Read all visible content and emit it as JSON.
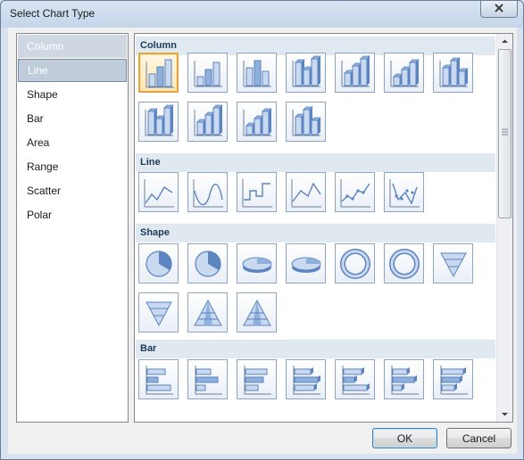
{
  "window": {
    "title": "Select Chart Type"
  },
  "categories": [
    {
      "label": "Column"
    },
    {
      "label": "Line"
    },
    {
      "label": "Shape"
    },
    {
      "label": "Bar"
    },
    {
      "label": "Area"
    },
    {
      "label": "Range"
    },
    {
      "label": "Scatter"
    },
    {
      "label": "Polar"
    }
  ],
  "sections": [
    {
      "label": "Column",
      "kind": "column",
      "count": 11
    },
    {
      "label": "Line",
      "kind": "line",
      "count": 6
    },
    {
      "label": "Shape",
      "kind": "shape",
      "count": 10
    },
    {
      "label": "Bar",
      "kind": "bar",
      "count": 7
    }
  ],
  "buttons": {
    "ok": "OK",
    "cancel": "Cancel"
  },
  "colors": {
    "accent": "#4f79b8",
    "selection": "#e8a33c"
  }
}
